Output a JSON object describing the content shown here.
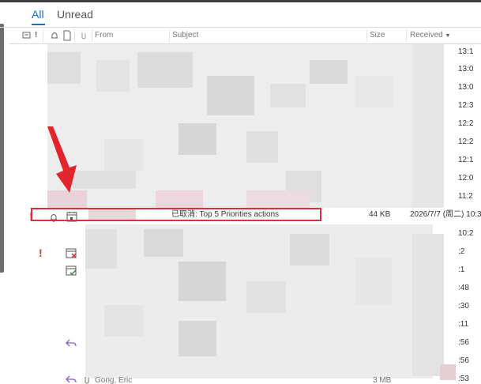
{
  "tabs": [
    {
      "label": "All",
      "active": true
    },
    {
      "label": "Unread",
      "active": false
    }
  ],
  "columns": {
    "from": "From",
    "subject": "Subject",
    "size": "Size",
    "received": "Received",
    "received_sort": "descending"
  },
  "header_icons": [
    "importance-icon",
    "reminder-icon",
    "document-icon",
    "attachment-icon",
    "flag-icon"
  ],
  "highlighted_row": {
    "importance": "!",
    "subject": "已取消: Top 5 Priorities actions",
    "size": "44 KB",
    "received": "2026/7/7 (周二) 10:3"
  },
  "bottom_row": {
    "from": "Gong, Eric",
    "size": "3 MB"
  },
  "received_times": [
    "13:1",
    "13:0",
    "13:0",
    "12:3",
    "12:2",
    "12:2",
    "12:1",
    "12:0",
    "11:2",
    "10:2",
    ":2",
    ":1",
    ":48",
    ":30",
    ":11",
    ":56",
    ":56",
    ":53"
  ],
  "colors": {
    "accent": "#1a6fc4",
    "highlight_red": "#d9323d",
    "reply_purple": "#8b5cc9",
    "calendar_green": "#2f8a3a"
  }
}
